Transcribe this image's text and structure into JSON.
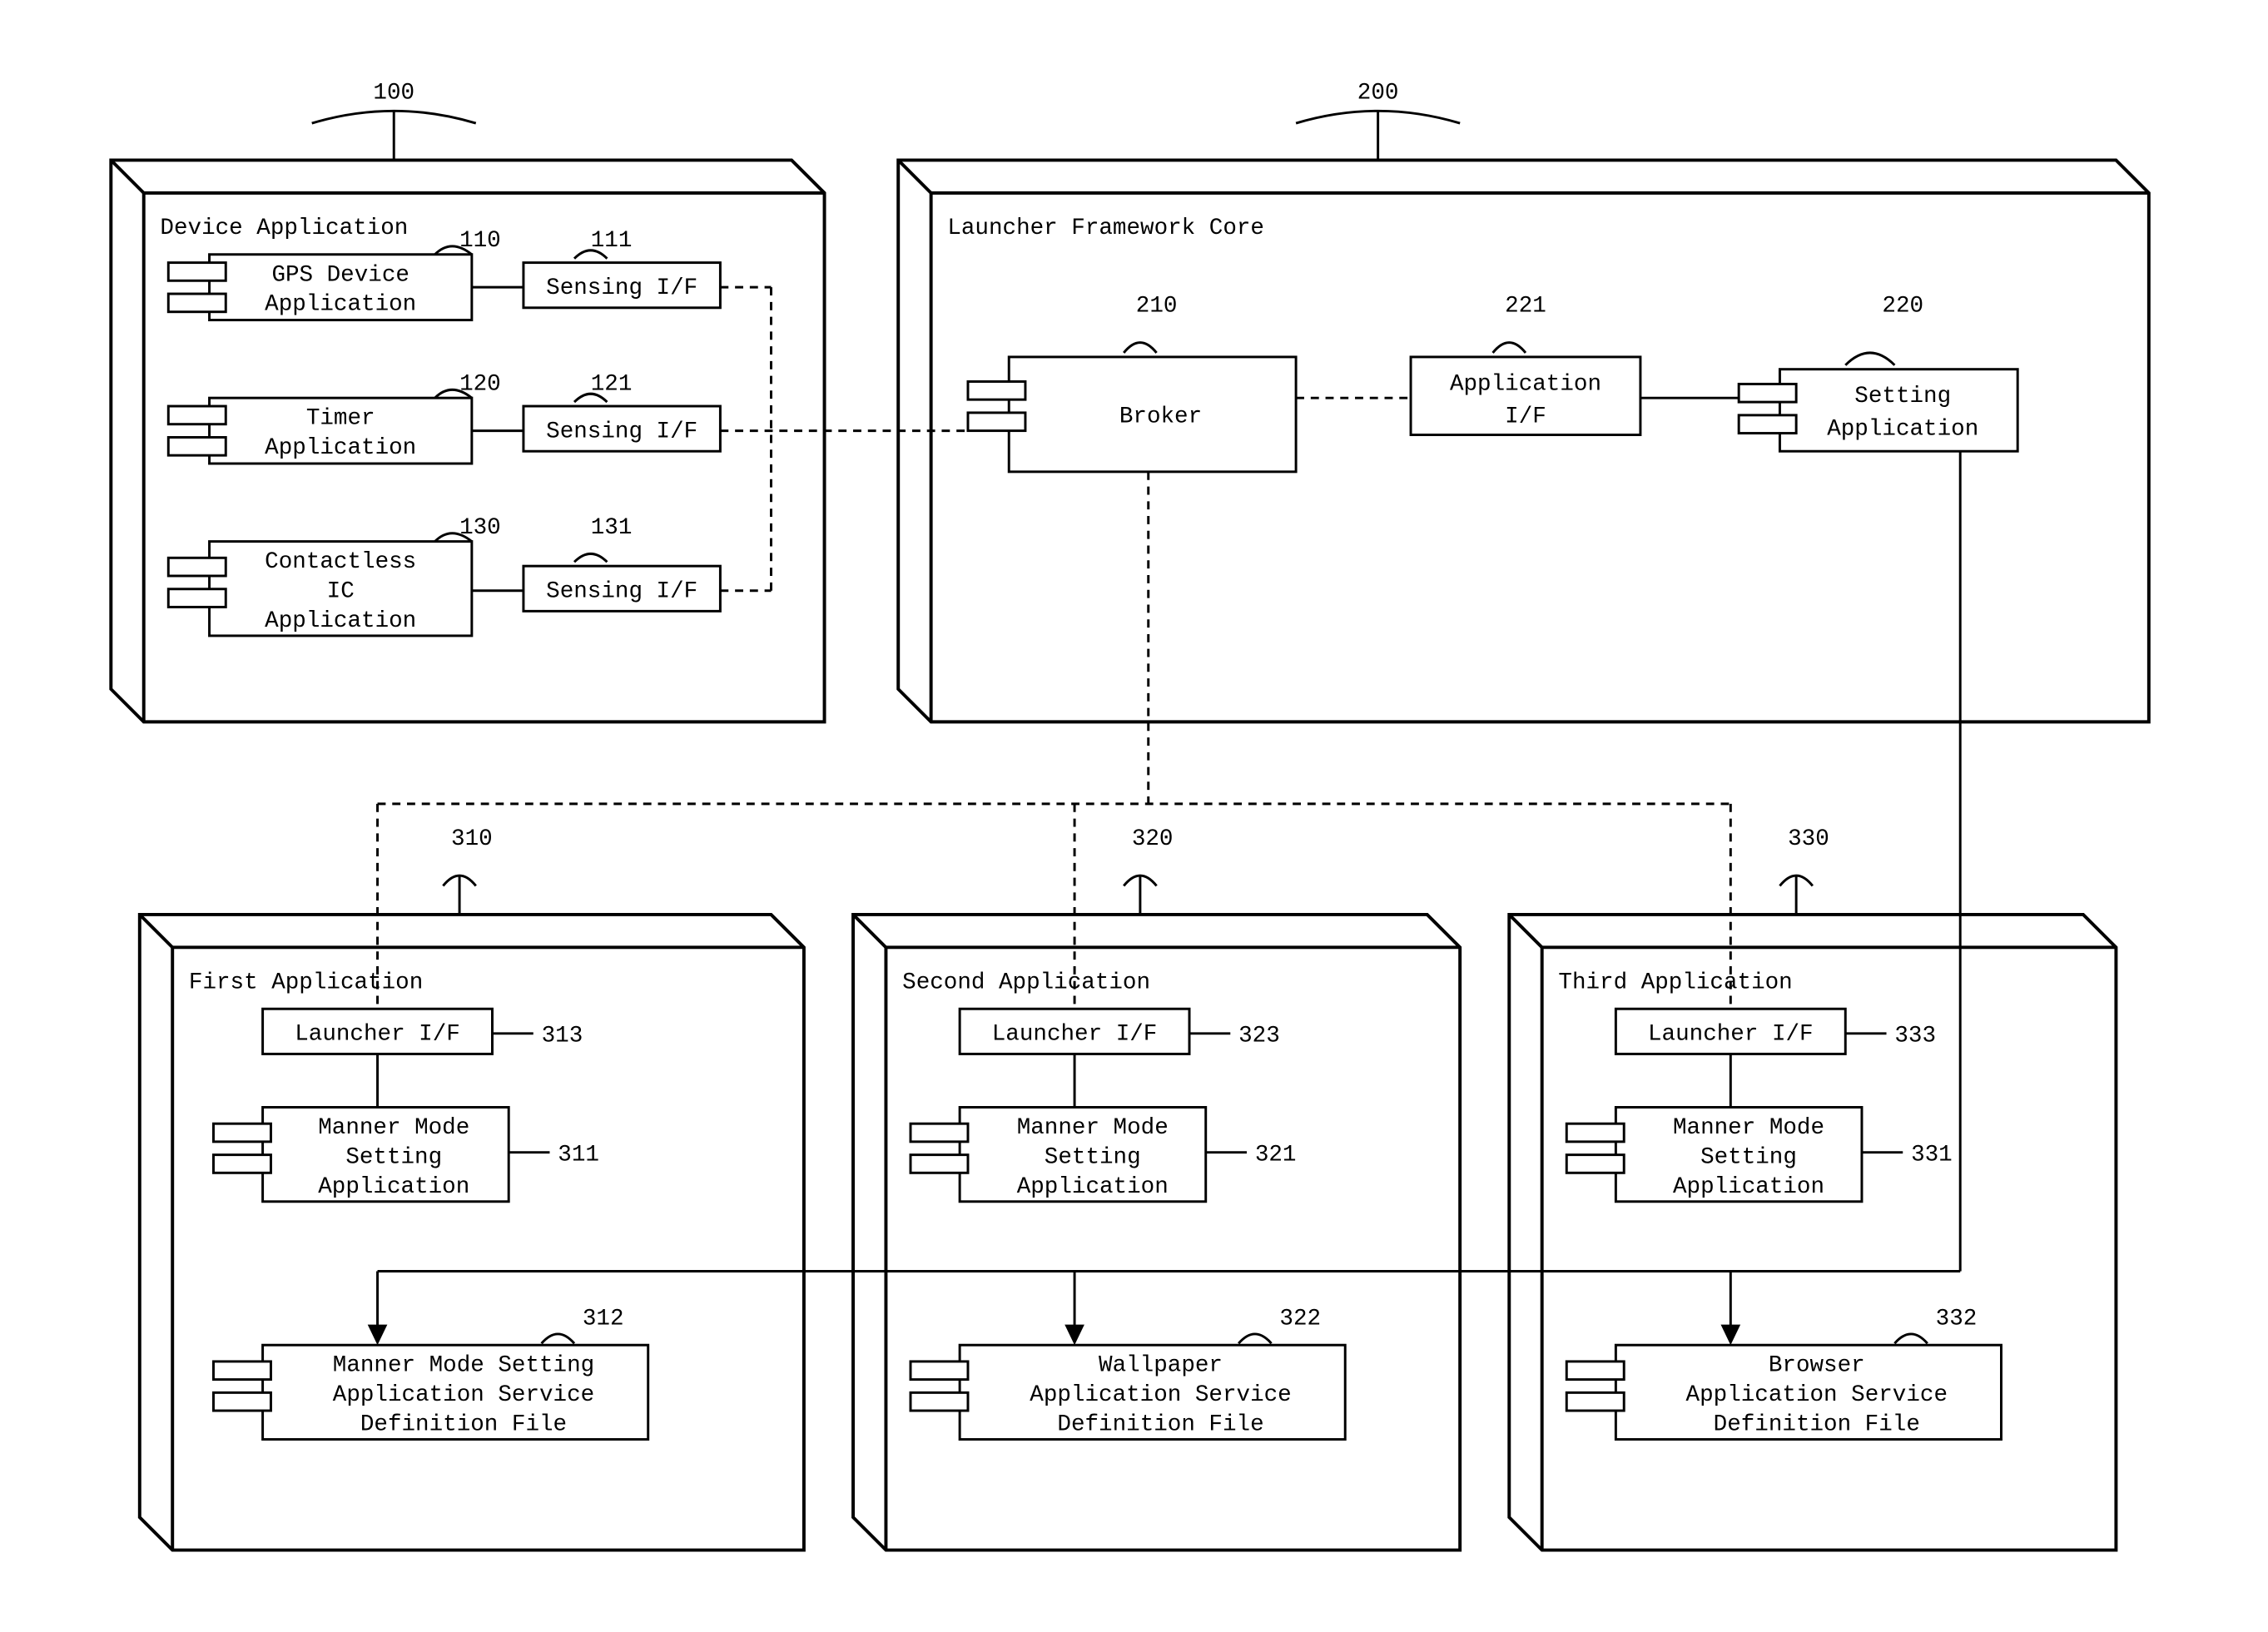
{
  "blocks": {
    "device_app": {
      "title": "Device Application",
      "ref": "100"
    },
    "launcher_core": {
      "title": "Launcher Framework Core",
      "ref": "200"
    },
    "first_app": {
      "title": "First Application",
      "ref": "310"
    },
    "second_app": {
      "title": "Second Application",
      "ref": "320"
    },
    "third_app": {
      "title": "Third Application",
      "ref": "330"
    }
  },
  "components": {
    "gps": {
      "label1": "GPS Device",
      "label2": "Application",
      "ref": "110"
    },
    "gps_if": {
      "label": "Sensing I/F",
      "ref": "111"
    },
    "timer": {
      "label1": "Timer",
      "label2": "Application",
      "ref": "120"
    },
    "timer_if": {
      "label": "Sensing I/F",
      "ref": "121"
    },
    "cic": {
      "label1": "Contactless",
      "label2": "IC",
      "label3": "Application",
      "ref": "130"
    },
    "cic_if": {
      "label": "Sensing I/F",
      "ref": "131"
    },
    "broker": {
      "label": "Broker",
      "ref": "210"
    },
    "app_if": {
      "label1": "Application",
      "label2": "I/F",
      "ref": "221"
    },
    "setting_app": {
      "label1": "Setting",
      "label2": "Application",
      "ref": "220"
    },
    "launcher_if_1": {
      "label": "Launcher I/F",
      "ref": "313"
    },
    "manner_1": {
      "label1": "Manner Mode",
      "label2": "Setting",
      "label3": "Application",
      "ref": "311"
    },
    "def_1": {
      "label1": "Manner Mode Setting",
      "label2": "Application Service",
      "label3": "Definition File",
      "ref": "312"
    },
    "launcher_if_2": {
      "label": "Launcher I/F",
      "ref": "323"
    },
    "manner_2": {
      "label1": "Manner Mode",
      "label2": "Setting",
      "label3": "Application",
      "ref": "321"
    },
    "def_2": {
      "label1": "Wallpaper",
      "label2": "Application Service",
      "label3": "Definition File",
      "ref": "322"
    },
    "launcher_if_3": {
      "label": "Launcher I/F",
      "ref": "333"
    },
    "manner_3": {
      "label1": "Manner Mode",
      "label2": "Setting",
      "label3": "Application",
      "ref": "331"
    },
    "def_3": {
      "label1": "Browser",
      "label2": "Application Service",
      "label3": "Definition File",
      "ref": "332"
    }
  }
}
